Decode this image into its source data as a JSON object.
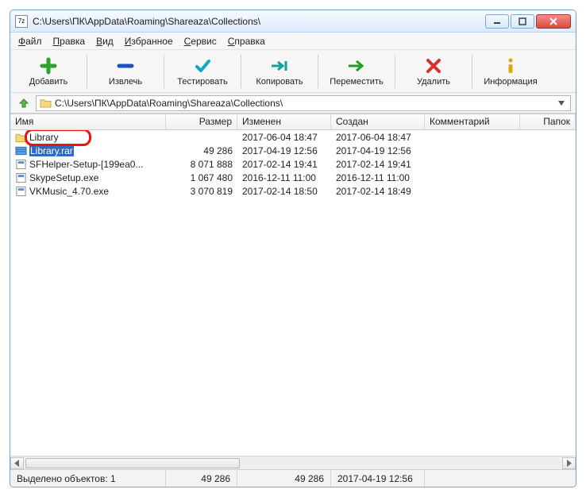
{
  "window": {
    "app_icon_text": "7z",
    "title": "C:\\Users\\ПК\\AppData\\Roaming\\Shareaza\\Collections\\"
  },
  "menu": {
    "file": {
      "hot": "Ф",
      "rest": "айл"
    },
    "edit": {
      "hot": "П",
      "rest": "равка"
    },
    "view": {
      "hot": "В",
      "rest": "ид"
    },
    "fav": {
      "hot": "И",
      "rest": "збранное"
    },
    "tools": {
      "hot": "С",
      "rest": "ервис"
    },
    "help": {
      "hot": "С",
      "rest": "правка"
    }
  },
  "toolbar": {
    "add": "Добавить",
    "extract": "Извлечь",
    "test": "Тестировать",
    "copy": "Копировать",
    "move": "Переместить",
    "delete": "Удалить",
    "info": "Информация"
  },
  "nav": {
    "path": "C:\\Users\\ПК\\AppData\\Roaming\\Shareaza\\Collections\\"
  },
  "columns": {
    "name": "Имя",
    "size": "Размер",
    "modified": "Изменен",
    "created": "Создан",
    "comment": "Комментарий",
    "folders": "Папок"
  },
  "rows": [
    {
      "icon": "folder",
      "name": "Library",
      "size": "",
      "mod": "2017-06-04 18:47",
      "cre": "2017-06-04 18:47",
      "selected": false,
      "annot": true
    },
    {
      "icon": "rar",
      "name": "Library.rar",
      "size": "49 286",
      "mod": "2017-04-19 12:56",
      "cre": "2017-04-19 12:56",
      "selected": true
    },
    {
      "icon": "exe",
      "name": "SFHelper-Setup-[199ea0...",
      "size": "8 071 888",
      "mod": "2017-02-14 19:41",
      "cre": "2017-02-14 19:41"
    },
    {
      "icon": "exe",
      "name": "SkypeSetup.exe",
      "size": "1 067 480",
      "mod": "2016-12-11 11:00",
      "cre": "2016-12-11 11:00"
    },
    {
      "icon": "exe",
      "name": "VKMusic_4.70.exe",
      "size": "3 070 819",
      "mod": "2017-02-14 18:50",
      "cre": "2017-02-14 18:49"
    }
  ],
  "status": {
    "selected_label": "Выделено объектов: 1",
    "size": "49 286",
    "size2": "49 286",
    "date": "2017-04-19 12:56"
  }
}
